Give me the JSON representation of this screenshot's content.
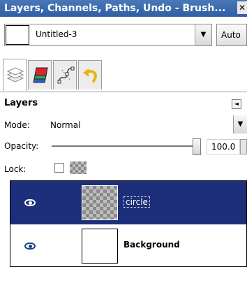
{
  "window": {
    "title": "Layers, Channels, Paths, Undo - Brush...",
    "close_glyph": "✕"
  },
  "image_menu": {
    "image_name": "Untitled-3",
    "dropdown_glyph": "▼",
    "auto_label": "Auto"
  },
  "tabs": [
    {
      "name": "layers",
      "icon": "layers-icon"
    },
    {
      "name": "channels",
      "icon": "channels-icon"
    },
    {
      "name": "paths",
      "icon": "paths-icon"
    },
    {
      "name": "undo",
      "icon": "undo-icon"
    }
  ],
  "panel": {
    "title": "Layers",
    "menu_glyph": "◄",
    "mode_label": "Mode:",
    "mode_value": "Normal",
    "mode_dropdown_glyph": "▼",
    "opacity_label": "Opacity:",
    "opacity_value": "100.0",
    "opacity_level": 1.0,
    "lock_label": "Lock:"
  },
  "layers": [
    {
      "name": "circle",
      "selected": true,
      "visible": true,
      "thumbnail": "transparent"
    },
    {
      "name": "Background",
      "selected": false,
      "visible": true,
      "thumbnail": "white"
    }
  ],
  "colors": {
    "title_bar": "#2f5ea3",
    "selection": "#1d2f7a"
  }
}
